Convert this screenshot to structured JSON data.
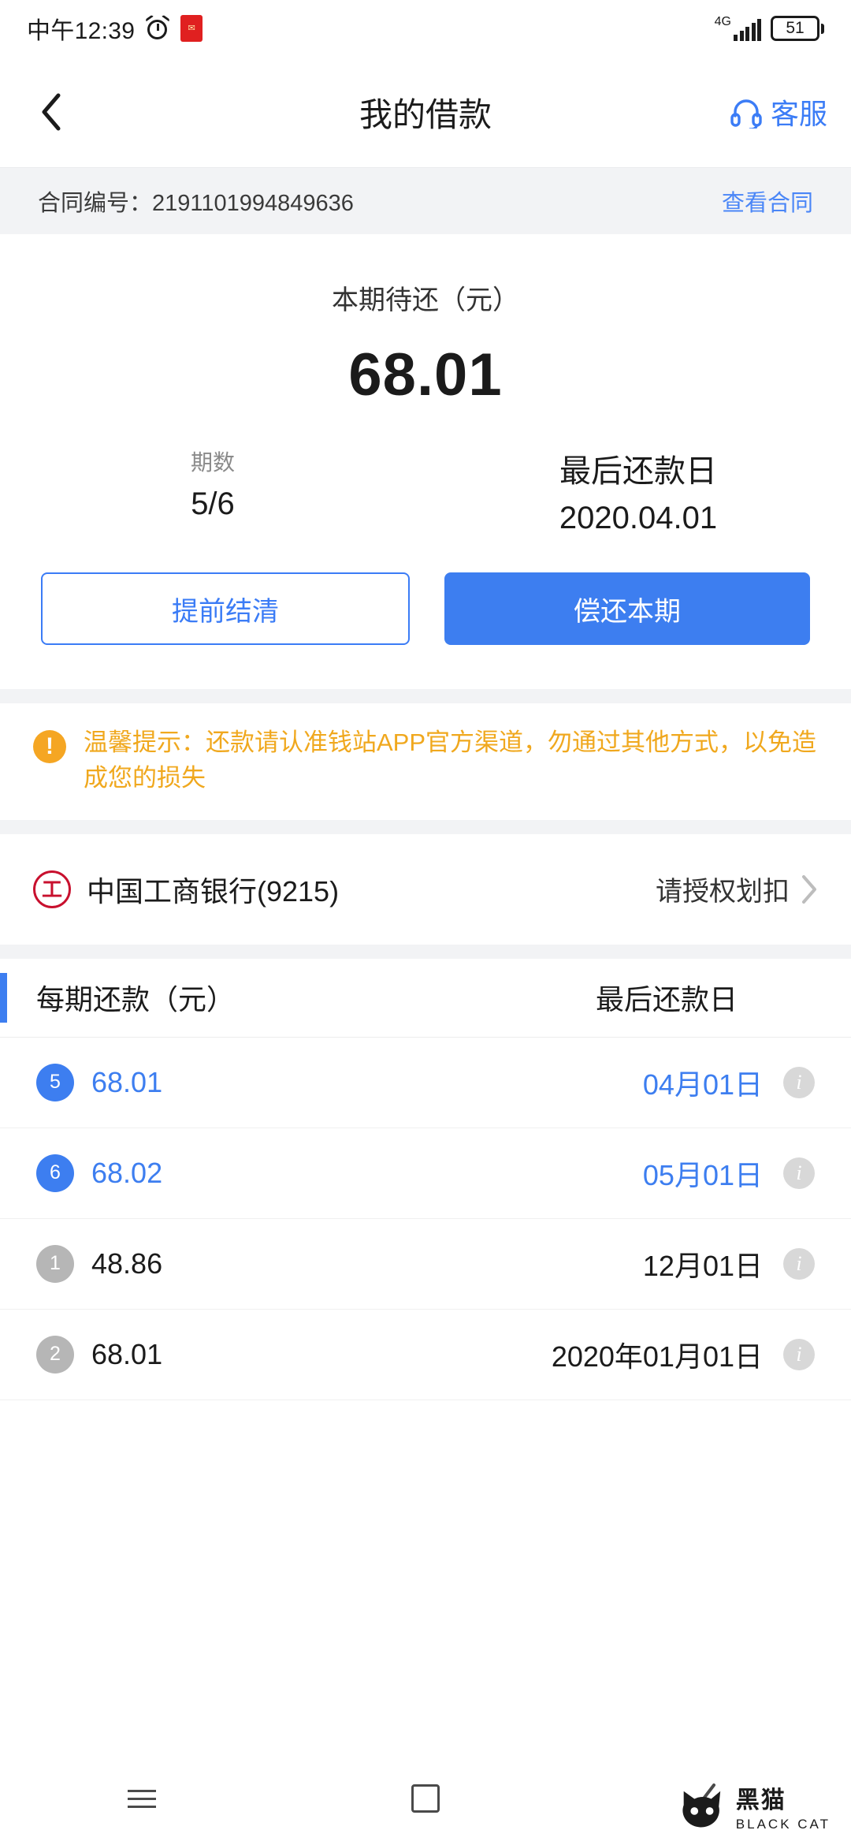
{
  "status_bar": {
    "time": "中午12:39",
    "alarm_icon": "alarm-clock-icon",
    "app_icon": "red-app-icon",
    "network_type": "4G",
    "signal_icon": "signal-bars-icon",
    "battery_level": "51"
  },
  "header": {
    "back_icon": "back-chevron-icon",
    "title": "我的借款",
    "service_icon": "headset-icon",
    "service_label": "客服"
  },
  "contract": {
    "label_value": "合同编号：2191101994849636",
    "view_link": "查看合同"
  },
  "summary": {
    "due_label": "本期待还（元）",
    "due_amount": "68.01",
    "period_label": "期数",
    "period_value": "5/6",
    "due_date_label": "最后还款日",
    "due_date_value": "2020.04.01",
    "btn_settle": "提前结清",
    "btn_repay": "偿还本期"
  },
  "tip": {
    "icon": "warning-exclamation-icon",
    "text": "温馨提示：还款请认准钱站APP官方渠道，勿通过其他方式，以免造成您的损失"
  },
  "bank": {
    "logo": "icbc-bank-logo",
    "logo_char": "工",
    "name": "中国工商银行(9215)",
    "action_text": "请授权划扣",
    "chevron_icon": "chevron-right-icon"
  },
  "schedule": {
    "col_amount": "每期还款（元）",
    "col_date": "最后还款日",
    "rows": [
      {
        "period": "5",
        "amount": "68.01",
        "date": "04月01日",
        "state": "active"
      },
      {
        "period": "6",
        "amount": "68.02",
        "date": "05月01日",
        "state": "active"
      },
      {
        "period": "1",
        "amount": "48.86",
        "date": "12月01日",
        "state": "past"
      },
      {
        "period": "2",
        "amount": "68.01",
        "date": "2020年01月01日",
        "state": "past"
      }
    ],
    "info_icon": "info-icon"
  },
  "bottom_nav": {
    "menu_icon": "menu-icon",
    "home_icon": "home-square-icon",
    "back_icon": "back-chevron-icon"
  },
  "watermark": {
    "cn": "黑猫",
    "en": "BLACK CAT",
    "icon": "black-cat-logo"
  },
  "colors": {
    "accent_blue": "#3d7ef0",
    "link_blue": "#4a86f7",
    "tip_orange": "#f0a81e",
    "bank_red": "#c8102e",
    "page_gray": "#f2f3f5"
  }
}
